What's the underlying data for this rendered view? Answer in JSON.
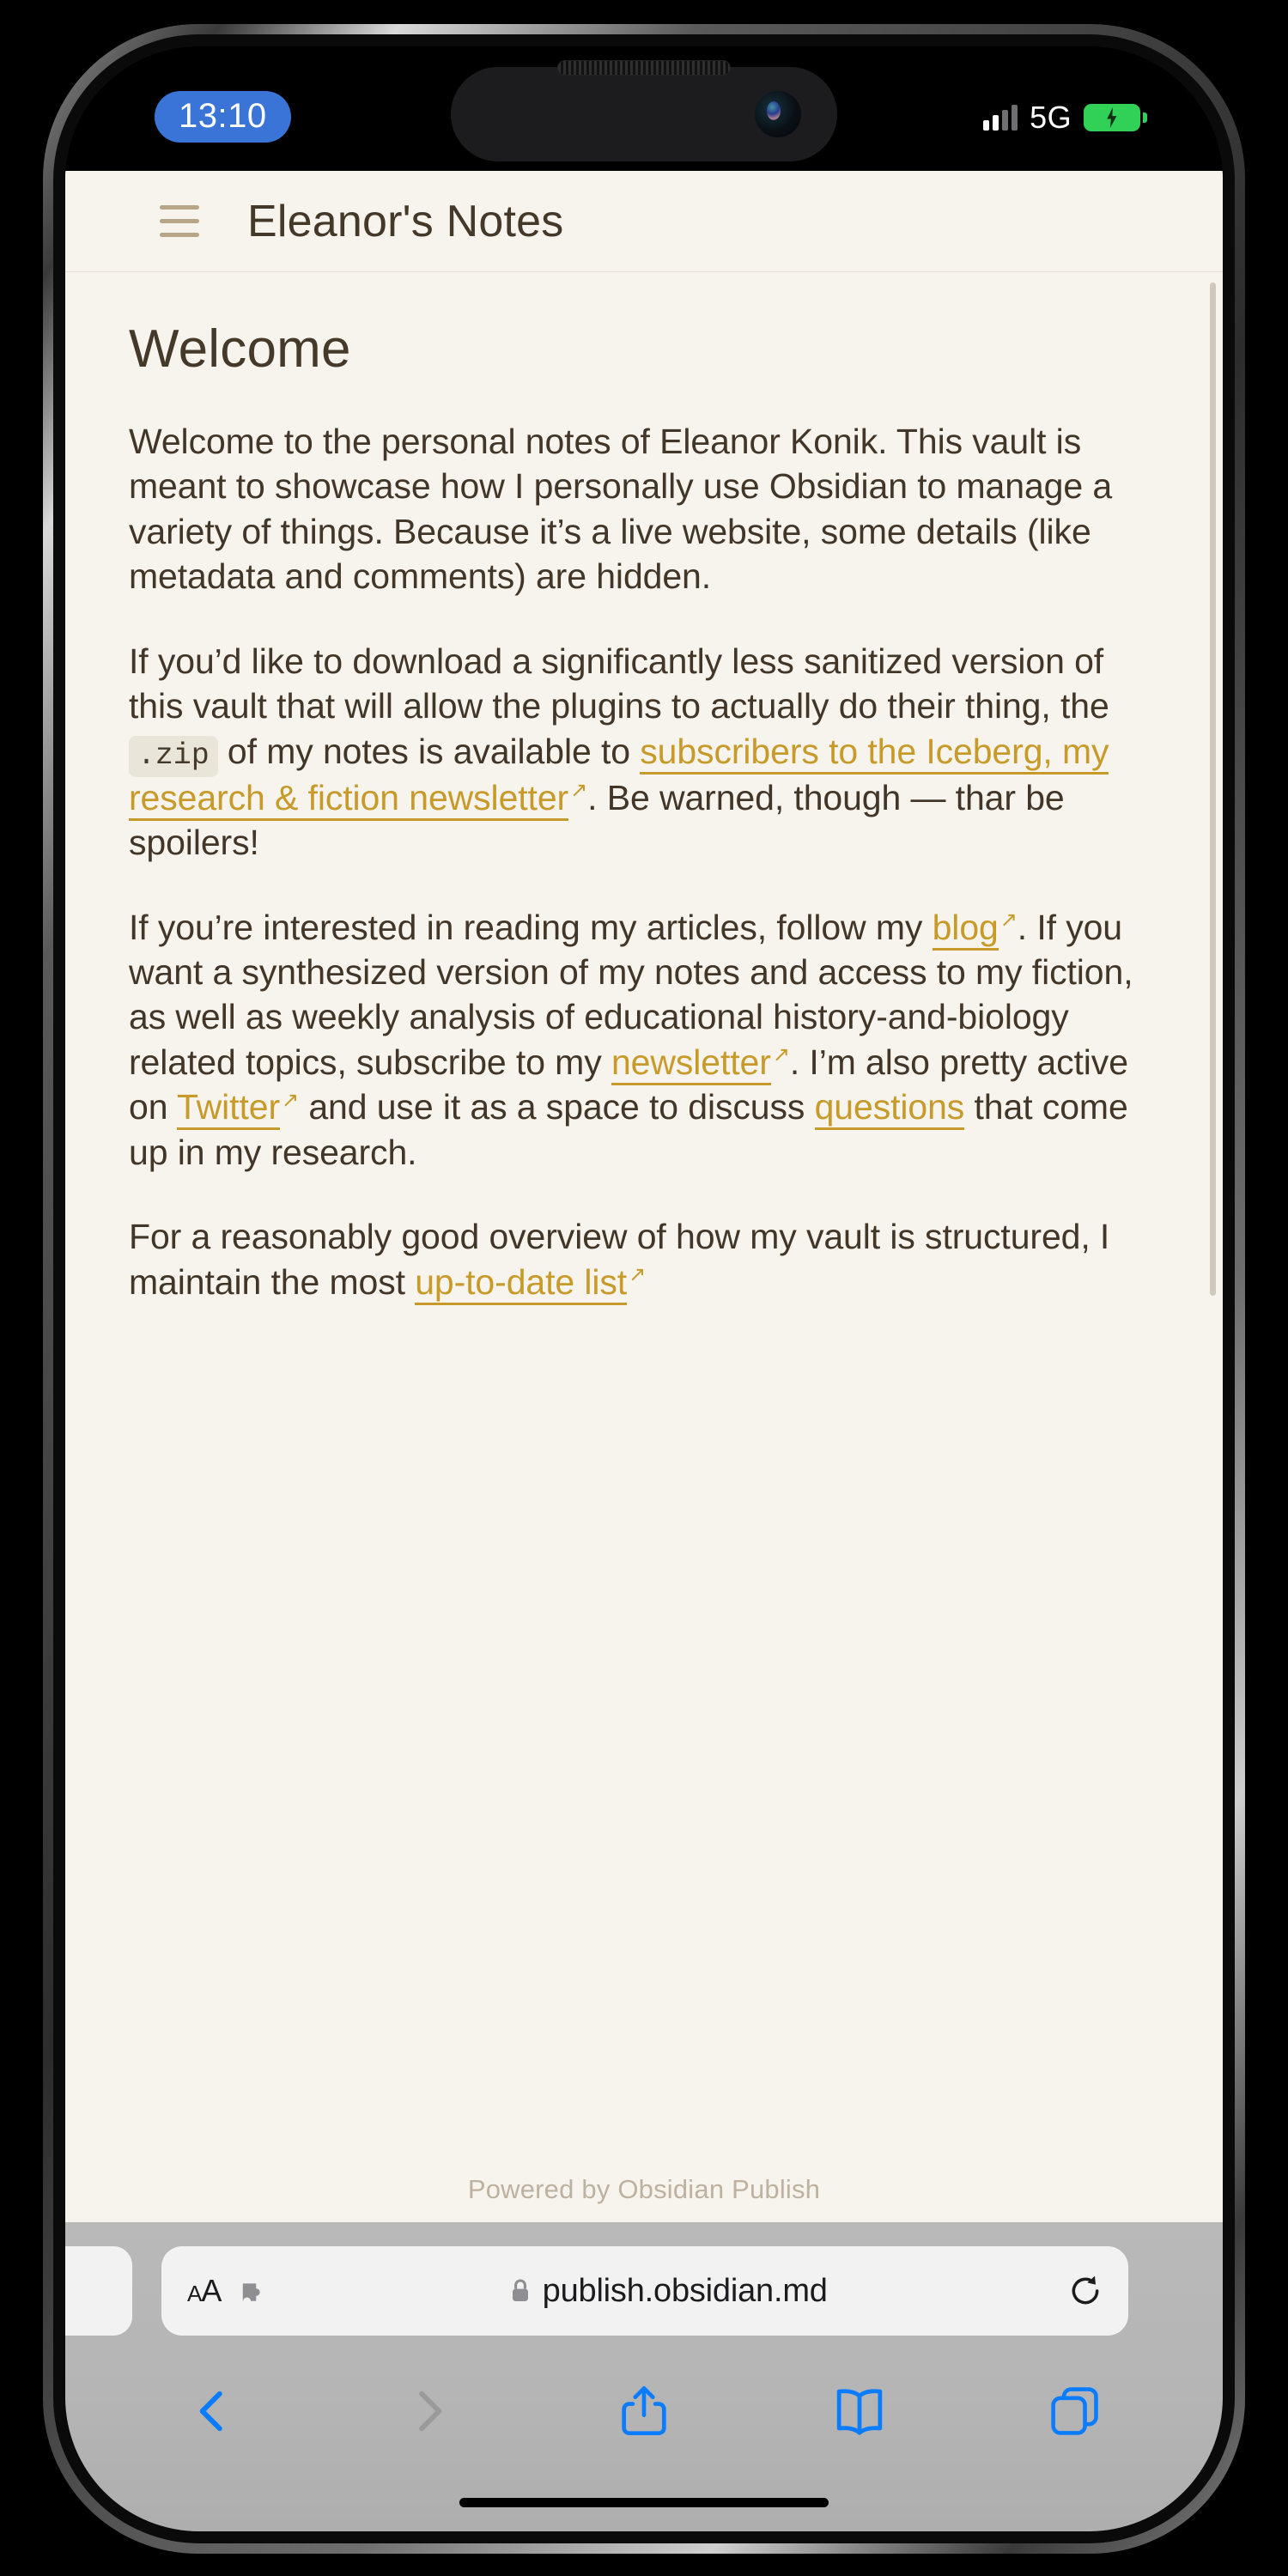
{
  "device": {
    "status_bar": {
      "time": "13:10",
      "network_label": "5G",
      "signal_icon": "signal-bars-icon",
      "battery_icon": "battery-charging-icon",
      "camera_icon": "front-camera-icon"
    },
    "home_indicator_icon": "home-indicator"
  },
  "webpage": {
    "header": {
      "menu_icon": "hamburger-menu-icon",
      "title": "Eleanor's Notes"
    },
    "note": {
      "title": "Welcome",
      "paragraphs": [
        {
          "id": "p1",
          "runs": [
            {
              "type": "text",
              "text": "Welcome to the personal notes of Eleanor Konik. This vault is meant to showcase how I personally use Obsidian to manage a variety of things. Because it’s a live website, some details (like metadata and comments) are hidden."
            }
          ]
        },
        {
          "id": "p2",
          "runs": [
            {
              "type": "text",
              "text": "If you’d like to download a significantly less sanitized version of this vault that will allow the plugins to actually do their thing, the "
            },
            {
              "type": "code",
              "text": ".zip"
            },
            {
              "type": "text",
              "text": " of my notes is available to "
            },
            {
              "type": "link",
              "text": "subscribers to the Iceberg, my research & fiction newsletter",
              "external": true
            },
            {
              "type": "text",
              "text": ". Be warned, though — thar be spoilers!"
            }
          ]
        },
        {
          "id": "p3",
          "runs": [
            {
              "type": "text",
              "text": "If you’re interested in reading my articles, follow my "
            },
            {
              "type": "link",
              "text": "blog",
              "external": true
            },
            {
              "type": "text",
              "text": ". If you want a synthesized version of my notes and access to my fiction, as well as weekly analysis of educational history-and-biology related topics, subscribe to my "
            },
            {
              "type": "link",
              "text": "newsletter",
              "external": true
            },
            {
              "type": "text",
              "text": ". I’m also pretty active on "
            },
            {
              "type": "link",
              "text": "Twitter",
              "external": true
            },
            {
              "type": "text",
              "text": " and use it as a space to discuss "
            },
            {
              "type": "link",
              "text": "questions",
              "external": false
            },
            {
              "type": "text",
              "text": " that come up in my research."
            }
          ]
        },
        {
          "id": "p4",
          "runs": [
            {
              "type": "text",
              "text": "For a reasonably good overview of how my vault is structured, I maintain the most "
            },
            {
              "type": "link",
              "text": "up-to-date list",
              "external": true
            },
            {
              "type": "text",
              "text": ""
            }
          ]
        }
      ]
    },
    "footer": {
      "powered_by": "Powered by Obsidian Publish"
    },
    "colors": {
      "background": "#f7f4ee",
      "text": "#413627",
      "link": "#c79a2a",
      "menu_icon": "#b9a689"
    }
  },
  "browser": {
    "url_bar": {
      "text_size_label_large": "A",
      "text_size_label_small": "A",
      "extensions_icon": "puzzle-piece-icon",
      "lock_icon": "lock-icon",
      "url": "publish.obsidian.md",
      "reload_icon": "reload-icon"
    },
    "toolbar": {
      "back_icon": "chevron-left-icon",
      "forward_icon": "chevron-right-icon",
      "share_icon": "share-icon",
      "bookmarks_icon": "book-icon",
      "tabs_icon": "tabs-icon"
    },
    "accent_color": "#0a7cff",
    "disabled_color": "#9a9a9a"
  }
}
